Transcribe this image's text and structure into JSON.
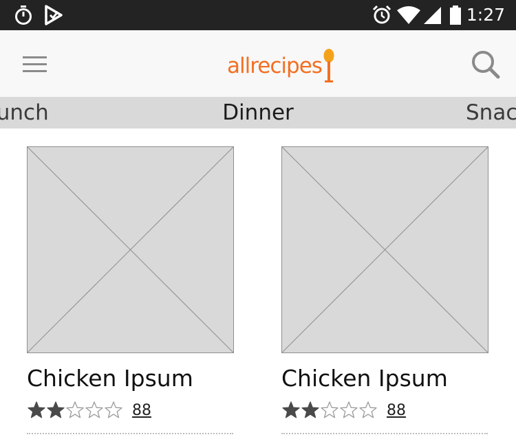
{
  "status_bar": {
    "time": "1:27",
    "left_icons": [
      "stopwatch-icon",
      "play-store-icon"
    ],
    "right_icons": [
      "alarm-icon",
      "wifi-icon",
      "signal-icon",
      "battery-icon"
    ]
  },
  "app_bar": {
    "logo_text": "allrecipes",
    "menu_icon": "hamburger-menu-icon",
    "search_icon": "search-icon",
    "brand_color": "#f36f21"
  },
  "tabs": {
    "left_partial": "Lunch",
    "selected": "Dinner",
    "right_partial": "Snacks"
  },
  "recipes": [
    {
      "title": "Chicken Ipsum",
      "rating": 2,
      "rating_max": 5,
      "review_count": "88"
    },
    {
      "title": "Chicken Ipsum",
      "rating": 2,
      "rating_max": 5,
      "review_count": "88"
    }
  ]
}
